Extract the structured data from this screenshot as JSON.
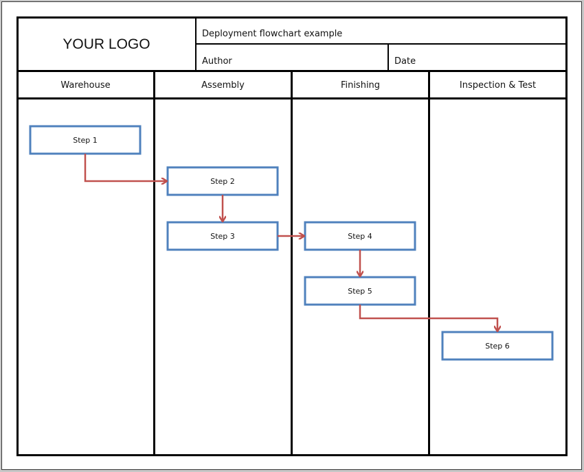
{
  "header": {
    "logo": "YOUR LOGO",
    "title": "Deployment flowchart example",
    "author_label": "Author",
    "date_label": "Date"
  },
  "lanes": [
    {
      "label": "Warehouse"
    },
    {
      "label": "Assembly"
    },
    {
      "label": "Finishing"
    },
    {
      "label": "Inspection & Test"
    }
  ],
  "steps": [
    {
      "id": "s1",
      "label": "Step 1",
      "lane": 0,
      "row": 0
    },
    {
      "id": "s2",
      "label": "Step 2",
      "lane": 1,
      "row": 1
    },
    {
      "id": "s3",
      "label": "Step 3",
      "lane": 1,
      "row": 2
    },
    {
      "id": "s4",
      "label": "Step 4",
      "lane": 2,
      "row": 2
    },
    {
      "id": "s5",
      "label": "Step 5",
      "lane": 2,
      "row": 3
    },
    {
      "id": "s6",
      "label": "Step 6",
      "lane": 3,
      "row": 4
    }
  ],
  "connections": [
    {
      "from": "s1",
      "to": "s2",
      "route": "down-right"
    },
    {
      "from": "s2",
      "to": "s3",
      "route": "down"
    },
    {
      "from": "s3",
      "to": "s4",
      "route": "right"
    },
    {
      "from": "s4",
      "to": "s5",
      "route": "down"
    },
    {
      "from": "s5",
      "to": "s6",
      "route": "down-right-down"
    }
  ],
  "colors": {
    "box_border": "#4f81bd",
    "arrow": "#c0504d",
    "grid": "#000000"
  }
}
